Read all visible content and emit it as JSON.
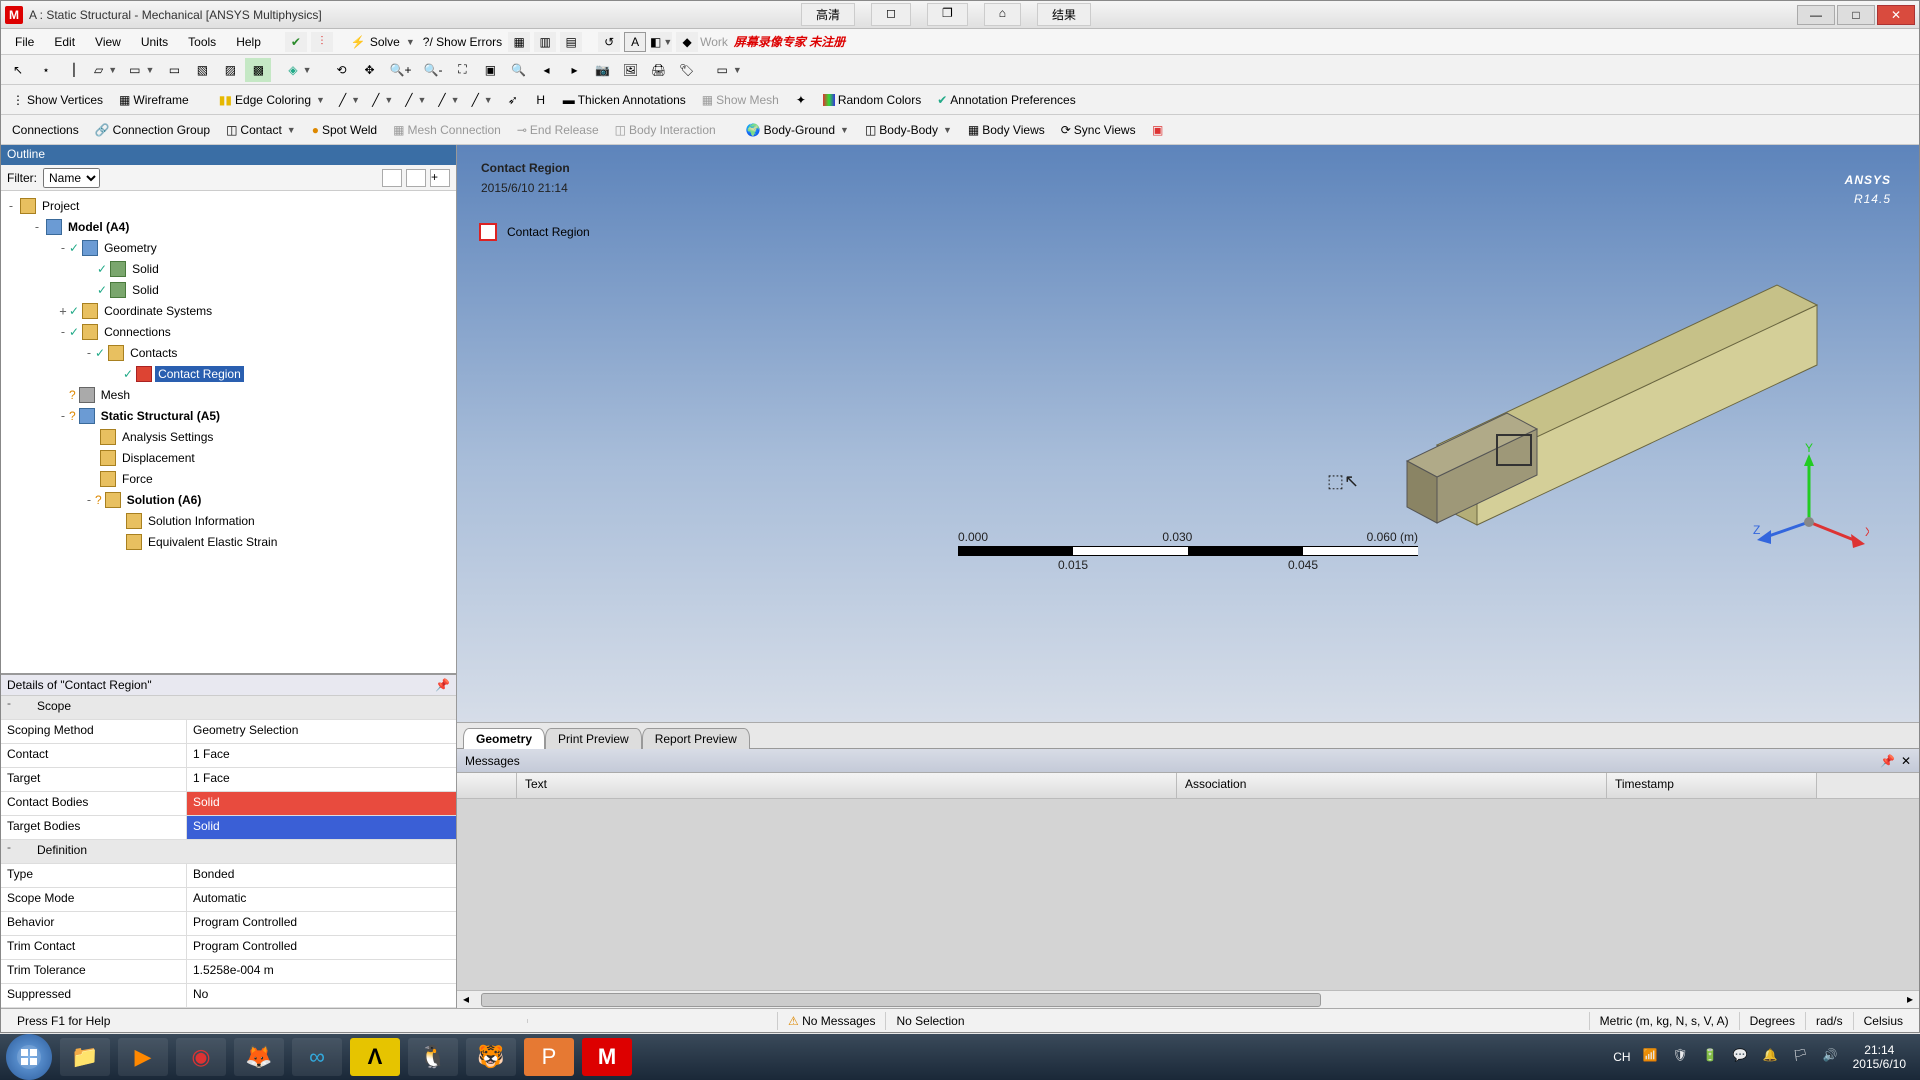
{
  "titlebar": {
    "title": "A : Static Structural - Mechanical [ANSYS Multiphysics]",
    "ext": [
      "高清",
      "结果"
    ]
  },
  "menus": [
    "File",
    "Edit",
    "View",
    "Units",
    "Tools",
    "Help"
  ],
  "menu_solve": "Solve",
  "menu_errors": "?/ Show Errors",
  "wb_label": "Work",
  "red_banner": "屏幕录像专家  未注册",
  "tb2": {
    "showverts": "Show Vertices",
    "wireframe": "Wireframe",
    "edgecolor": "Edge Coloring",
    "thicken": "Thicken Annotations",
    "showmesh": "Show Mesh",
    "random": "Random Colors",
    "annprefs": "Annotation Preferences"
  },
  "tb3": {
    "connections": "Connections",
    "conngroup": "Connection Group",
    "contact": "Contact",
    "spotweld": "Spot Weld",
    "meshconn": "Mesh Connection",
    "endrelease": "End Release",
    "bodyinter": "Body Interaction",
    "bodyground": "Body-Ground",
    "bodybody": "Body-Body",
    "bodyviews": "Body Views",
    "syncviews": "Sync Views"
  },
  "outline": {
    "header": "Outline",
    "filter_label": "Filter:",
    "filter_value": "Name",
    "tree": {
      "project": "Project",
      "model": "Model (A4)",
      "geometry": "Geometry",
      "solid1": "Solid",
      "solid2": "Solid",
      "coords": "Coordinate Systems",
      "connections": "Connections",
      "contacts": "Contacts",
      "contactregion": "Contact Region",
      "mesh": "Mesh",
      "static": "Static Structural (A5)",
      "analysis": "Analysis Settings",
      "disp": "Displacement",
      "force": "Force",
      "solution": "Solution (A6)",
      "solinfo": "Solution Information",
      "eqstrain": "Equivalent Elastic Strain"
    }
  },
  "details": {
    "header": "Details of \"Contact Region\"",
    "groups": {
      "scope": "Scope",
      "definition": "Definition"
    },
    "rows": {
      "scoping_k": "Scoping Method",
      "scoping_v": "Geometry Selection",
      "contact_k": "Contact",
      "contact_v": "1 Face",
      "target_k": "Target",
      "target_v": "1 Face",
      "cbodies_k": "Contact Bodies",
      "cbodies_v": "Solid",
      "tbodies_k": "Target Bodies",
      "tbodies_v": "Solid",
      "type_k": "Type",
      "type_v": "Bonded",
      "scopemode_k": "Scope Mode",
      "scopemode_v": "Automatic",
      "behavior_k": "Behavior",
      "behavior_v": "Program Controlled",
      "trim_k": "Trim Contact",
      "trim_v": "Program Controlled",
      "trimtol_k": "Trim Tolerance",
      "trimtol_v": "1.5258e-004 m",
      "supp_k": "Suppressed",
      "supp_v": "No"
    }
  },
  "viewport": {
    "title": "Contact Region",
    "timestamp": "2015/6/10 21:14",
    "legend": "Contact Region",
    "brand": "ANSYS",
    "version": "R14.5",
    "scale": {
      "t0": "0.000",
      "t1": "0.030",
      "t2": "0.060 (m)",
      "b0": "0.015",
      "b1": "0.045"
    },
    "axes": {
      "x": "X",
      "y": "Y",
      "z": "Z"
    }
  },
  "tabs3d": [
    "Geometry",
    "Print Preview",
    "Report Preview"
  ],
  "messages": {
    "header": "Messages",
    "cols": [
      "Text",
      "Association",
      "Timestamp"
    ]
  },
  "statusbar": {
    "help": "Press F1 for Help",
    "nomsg": "No Messages",
    "nosel": "No Selection",
    "units": "Metric (m, kg, N, s, V, A)",
    "deg": "Degrees",
    "rads": "rad/s",
    "cels": "Celsius"
  },
  "taskbar": {
    "ime": "CH",
    "time": "21:14",
    "date": "2015/6/10"
  }
}
